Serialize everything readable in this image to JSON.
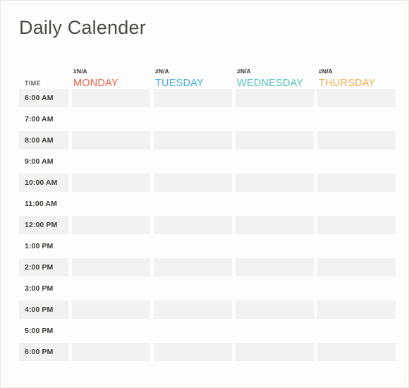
{
  "page": {
    "title": "Daily Calender"
  },
  "table": {
    "time_column_header": "TIME",
    "na_label": "#N/A",
    "days": [
      {
        "name": "MONDAY",
        "na": "#N/A",
        "color": "#ef6147"
      },
      {
        "name": "TUESDAY",
        "na": "#N/A",
        "color": "#45aedd"
      },
      {
        "name": "WEDNESDAY",
        "na": "#N/A",
        "color": "#57c3b5"
      },
      {
        "name": "THURSDAY",
        "na": "#N/A",
        "color": "#f0b04c"
      }
    ],
    "rows": [
      {
        "time": "6:00 AM",
        "shaded": true,
        "cells": [
          "",
          "",
          "",
          ""
        ]
      },
      {
        "time": "7:00 AM",
        "shaded": false,
        "cells": [
          "",
          "",
          "",
          ""
        ]
      },
      {
        "time": "8:00 AM",
        "shaded": true,
        "cells": [
          "",
          "",
          "",
          ""
        ]
      },
      {
        "time": "9:00 AM",
        "shaded": false,
        "cells": [
          "",
          "",
          "",
          ""
        ]
      },
      {
        "time": "10:00 AM",
        "shaded": true,
        "cells": [
          "",
          "",
          "",
          ""
        ]
      },
      {
        "time": "11:00 AM",
        "shaded": false,
        "cells": [
          "",
          "",
          "",
          ""
        ]
      },
      {
        "time": "12:00 PM",
        "shaded": true,
        "cells": [
          "",
          "",
          "",
          ""
        ]
      },
      {
        "time": "1:00 PM",
        "shaded": false,
        "cells": [
          "",
          "",
          "",
          ""
        ]
      },
      {
        "time": "2:00 PM",
        "shaded": true,
        "cells": [
          "",
          "",
          "",
          ""
        ]
      },
      {
        "time": "3:00 PM",
        "shaded": false,
        "cells": [
          "",
          "",
          "",
          ""
        ]
      },
      {
        "time": "4:00 PM",
        "shaded": true,
        "cells": [
          "",
          "",
          "",
          ""
        ]
      },
      {
        "time": "5:00 PM",
        "shaded": false,
        "cells": [
          "",
          "",
          "",
          ""
        ]
      },
      {
        "time": "6:00 PM",
        "shaded": true,
        "cells": [
          "",
          "",
          "",
          ""
        ]
      }
    ]
  },
  "colors": {
    "title_text": "#4d4a45",
    "shaded_cell": "#f2f2f2",
    "page_background": "#ffffff",
    "frame_border": "#e6e6e4"
  }
}
